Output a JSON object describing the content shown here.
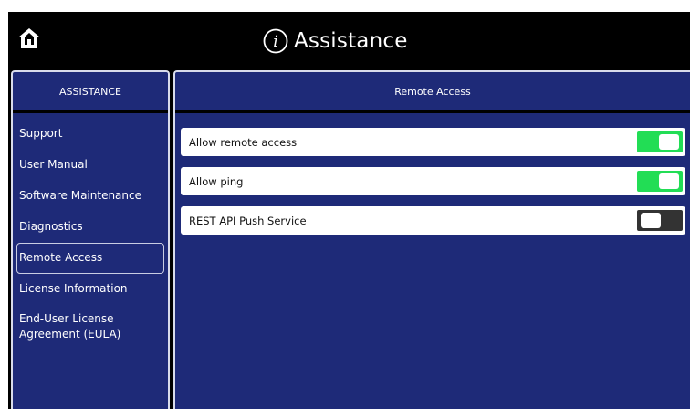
{
  "header": {
    "home_icon": "home-icon",
    "info_icon": "info-icon",
    "title": "Assistance"
  },
  "sidebar": {
    "heading": "ASSISTANCE",
    "items": [
      {
        "label": "Support",
        "selected": false
      },
      {
        "label": "User Manual",
        "selected": false
      },
      {
        "label": "Software Maintenance",
        "selected": false
      },
      {
        "label": "Diagnostics",
        "selected": false
      },
      {
        "label": "Remote Access",
        "selected": true
      },
      {
        "label": "License Information",
        "selected": false
      },
      {
        "label": "End-User License\nAgreement (EULA)",
        "selected": false
      }
    ]
  },
  "main": {
    "heading": "Remote Access",
    "settings": [
      {
        "label": "Allow remote access",
        "enabled": true
      },
      {
        "label": "Allow ping",
        "enabled": true
      },
      {
        "label": "REST API Push Service",
        "enabled": false
      }
    ]
  },
  "colors": {
    "panel": "#1e2a78",
    "toggle_on": "#22dd55",
    "toggle_off": "#333333",
    "background": "#000000"
  }
}
